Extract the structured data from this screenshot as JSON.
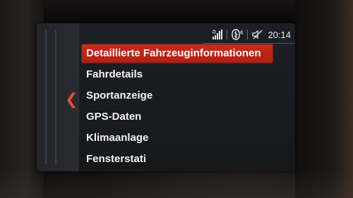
{
  "status_bar": {
    "signal_icon": "signal-bars-icon",
    "phone_icon": "bluetooth-phone-icon",
    "mute_icon": "speaker-muted-icon",
    "time": "20:14"
  },
  "navigation": {
    "back_icon": "chevron-left-icon",
    "back_glyph": "❮"
  },
  "menu": {
    "items": [
      {
        "label": "Detaillierte Fahrzeuginformationen",
        "selected": true
      },
      {
        "label": "Fahrdetails",
        "selected": false
      },
      {
        "label": "Sportanzeige",
        "selected": false
      },
      {
        "label": "GPS-Daten",
        "selected": false
      },
      {
        "label": "Klimaanlage",
        "selected": false
      },
      {
        "label": "Fensterstati",
        "selected": false
      }
    ]
  },
  "colors": {
    "accent": "#c92a1a",
    "text": "#f2f2f2",
    "screen_bg": "#1a1c21",
    "back_arrow": "#e0503a"
  }
}
